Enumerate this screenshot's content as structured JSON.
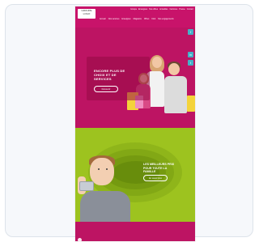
{
  "site": {
    "logo": {
      "line1": "GROUPE",
      "line2": "LOGO"
    },
    "top_links": [
      "Groupe",
      "Enseignes",
      "Nos offres",
      "Actualités",
      "Carrières",
      "Presse",
      "Contact"
    ],
    "main_nav": [
      "Accueil",
      "Nos services",
      "Enseignes",
      "Magasins",
      "Offres",
      "Club",
      "Nos engagements"
    ],
    "social": [
      "f",
      "in",
      "t"
    ],
    "hero1": {
      "title": "ENCORE PLUS DE CHOIX ET DE SERVICES",
      "button": "Découvrir"
    },
    "hero2": {
      "title": "LES MEILLEURS PRIX POUR TOUTE LA FAMILLE",
      "button": "En savoir plus"
    },
    "colors": {
      "magenta": "#bd1463",
      "lime": "#9dc31f",
      "accent_blue": "#43b1c7"
    }
  }
}
